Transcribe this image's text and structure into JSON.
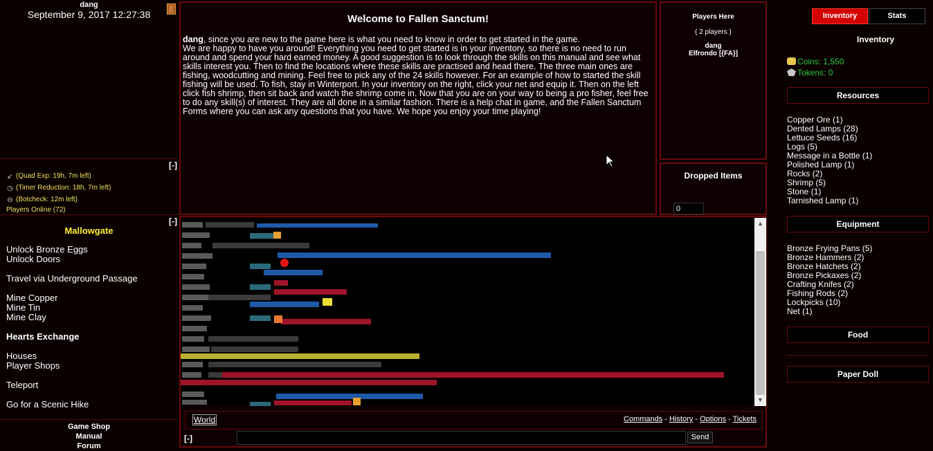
{
  "user": {
    "name": "dang",
    "datetime": "September 9, 2017 12:27:38"
  },
  "boosts": {
    "collapse": "[-]",
    "items": [
      {
        "icon": "arrow-icon",
        "text": "(Quad Exp: 19h, 7m left)"
      },
      {
        "icon": "clock-icon",
        "text": "(Timer Reduction: 18h, 7m left)"
      },
      {
        "icon": "no-entry-icon",
        "text": "(Botcheck: 12m left)"
      }
    ],
    "players_online": "Players Online (72)"
  },
  "location": {
    "collapse": "[-]",
    "title": "Mallowgate",
    "actions": [
      {
        "label": "Unlock Bronze Eggs",
        "bold": false
      },
      {
        "label": "Unlock Doors",
        "bold": false
      },
      {
        "label": "Travel via Underground Passage",
        "bold": false
      },
      {
        "label": "Mine Copper",
        "bold": false
      },
      {
        "label": "Mine Tin",
        "bold": false
      },
      {
        "label": "Mine Clay",
        "bold": false
      },
      {
        "label": "Hearts Exchange",
        "bold": true
      },
      {
        "label": "Houses",
        "bold": false
      },
      {
        "label": "Player Shops",
        "bold": false
      },
      {
        "label": "Teleport",
        "bold": false
      },
      {
        "label": "Go for a Scenic Hike",
        "bold": false
      }
    ]
  },
  "footer_links": [
    "Game Shop",
    "Manual",
    "Forum"
  ],
  "welcome": {
    "title": "Welcome to Fallen Sanctum!",
    "name": "dang",
    "intro": ", since you are new to the game here is what you need to know in order to get started in the game.",
    "body": "We are happy to have you around! Everything you need to get started is in your inventory, so there is no need to run around and spend your hard earned money. A good suggestion is to look through the skills on this manual and see what skills interest you. Then to find the locations where these skills are practised and head there. The three main ones are fishing, woodcutting and mining. Feel free to pick any of the 24 skills however. For an example of how to started the skill fishing will be used. To fish, stay in Winterport. In your inventory on the right, click your net and equip it. Then on the left click fish shrimp, then sit back and watch the shrimp come in. Now that you are on your way to being a pro fisher, feel free to do any skill(s) of interest. They are all done in a similar fashion. There is a help chat in game, and the Fallen Sanctum Forms where you can ask any questions that you have. We hope you enjoy your time playing!"
  },
  "players_here": {
    "title": "Players Here",
    "count": "( 2 players )",
    "names": [
      "dang",
      "Elfrondo [{FA}]"
    ]
  },
  "dropped": {
    "title": "Dropped Items",
    "count": "0"
  },
  "chat": {
    "channel": "World",
    "links": [
      "Commands",
      "History",
      "Options",
      "Tickets"
    ],
    "collapse": "[-]",
    "send": "Send"
  },
  "right": {
    "tabs": {
      "inventory": "Inventory",
      "stats": "Stats"
    },
    "title": "Inventory",
    "coins": "Coins: 1,550",
    "tokens": "Tokens: 0",
    "resources_title": "Resources",
    "resources": [
      "Copper Ore (1)",
      "Dented Lamps (28)",
      "Lettuce Seeds (16)",
      "Logs (5)",
      "Message in a Bottle (1)",
      "Polished Lamp (1)",
      "Rocks (2)",
      "Shrimp (5)",
      "Stone (1)",
      "Tarnished Lamp (1)"
    ],
    "equipment_title": "Equipment",
    "equipment": [
      "Bronze Frying Pans (5)",
      "Bronze Hammers (2)",
      "Bronze Hatchets (2)",
      "Bronze Pickaxes (2)",
      "Crafting Knifes (2)",
      "Fishing Rods (2)",
      "Lockpicks (10)",
      "Net (1)"
    ],
    "food_title": "Food",
    "paperdoll_title": "Paper Doll"
  },
  "colors": {
    "accent": "#d40000",
    "border": "#6b0a0a",
    "location": "#ffef3a",
    "currency": "#2ecc40",
    "boost": "#f0e060"
  }
}
